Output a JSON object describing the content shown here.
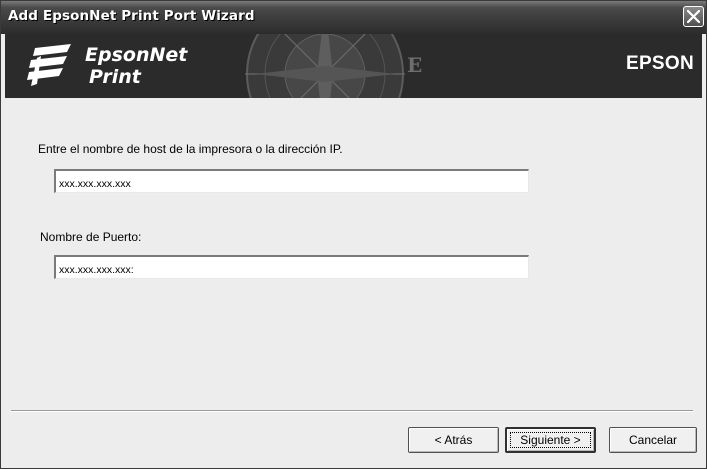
{
  "window": {
    "title": "Add EpsonNet Print Port Wizard"
  },
  "banner": {
    "logo_line1": "EpsonNet",
    "logo_line2": "Print",
    "brand": "EPSON"
  },
  "form": {
    "host_label": "Entre el nombre de host de la impresora o la dirección IP.",
    "host_value": "xxx.xxx.xxx.xxx",
    "port_label": "Nombre de Puerto:",
    "port_value": "xxx.xxx.xxx.xxx:"
  },
  "buttons": {
    "back": "< Atrás",
    "next": "Siguiente >",
    "cancel": "Cancelar"
  },
  "icons": {
    "close": "close-icon",
    "logo": "epsonnet-logo-icon",
    "banner_art": "compass-icon"
  }
}
